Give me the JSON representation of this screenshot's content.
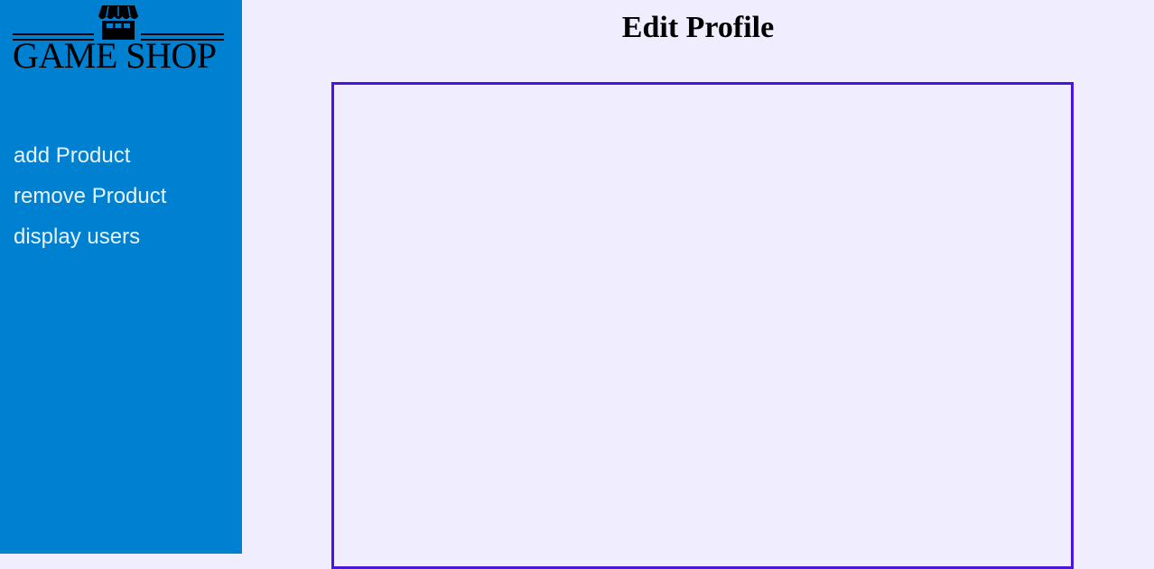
{
  "sidebar": {
    "logo_text": "GAME SHOP",
    "logo_icon": "storefront-icon",
    "items": [
      {
        "label": "add Product"
      },
      {
        "label": "remove Product"
      },
      {
        "label": "display users"
      }
    ]
  },
  "main": {
    "title": "Edit Profile"
  },
  "colors": {
    "sidebar_bg": "#0080d1",
    "page_bg": "#f0edfe",
    "nav_text": "#e6f3fb",
    "frame_border": "#4a14e0"
  }
}
